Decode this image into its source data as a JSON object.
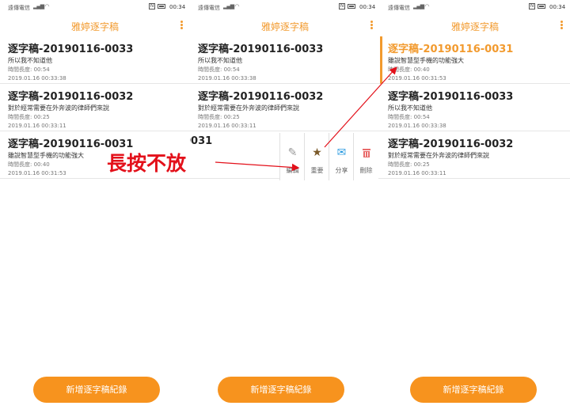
{
  "status": {
    "carrier": "遠傳電信",
    "time": "00:34"
  },
  "app_title": "雅婷逐字稿",
  "fab_label": "新增逐字稿紀錄",
  "screens": [
    {
      "items": [
        {
          "title": "逐字稿-20190116-0033",
          "desc": "所以我不知道他",
          "duration": "時間長度: 00:54",
          "date": "2019.01.16 00:33:38"
        },
        {
          "title": "逐字稿-20190116-0032",
          "desc": "對於經常需要在外奔波的律師們來說",
          "duration": "時間長度: 00:25",
          "date": "2019.01.16 00:33:11"
        },
        {
          "title": "逐字稿-20190116-0031",
          "desc": "雖說智慧型手機的功能強大",
          "duration": "時間長度: 00:40",
          "date": "2019.01.16 00:31:53"
        }
      ]
    },
    {
      "items": [
        {
          "title": "逐字稿-20190116-0033",
          "desc": "所以我不知道他",
          "duration": "時間長度: 00:54",
          "date": "2019.01.16 00:33:38"
        },
        {
          "title": "逐字稿-20190116-0032",
          "desc": "對於經常需要在外奔波的律師們來說",
          "duration": "時間長度: 00:25",
          "date": "2019.01.16 00:33:11"
        },
        {
          "title": "0031"
        }
      ],
      "actions": {
        "edit": "編輯",
        "star": "重要",
        "share": "分享",
        "delete": "刪除"
      }
    },
    {
      "items": [
        {
          "title": "逐字稿-20190116-0031",
          "desc": "雖說智慧型手機的功能強大",
          "duration": "時間長度: 00:40",
          "date": "2019.01.16 00:31:53"
        },
        {
          "title": "逐字稿-20190116-0033",
          "desc": "所以我不知道他",
          "duration": "時間長度: 00:54",
          "date": "2019.01.16 00:33:38"
        },
        {
          "title": "逐字稿-20190116-0032",
          "desc": "對於經常需要在外奔波的律師們來說",
          "duration": "時間長度: 00:25",
          "date": "2019.01.16 00:33:11"
        }
      ]
    }
  ],
  "annotation": "長按不放",
  "colors": {
    "accent": "#f29a2e",
    "fab": "#f7931e",
    "annotation_red": "#e3101a",
    "star": "#7b5a2a",
    "share": "#2b9be0",
    "delete": "#e86a6a"
  }
}
